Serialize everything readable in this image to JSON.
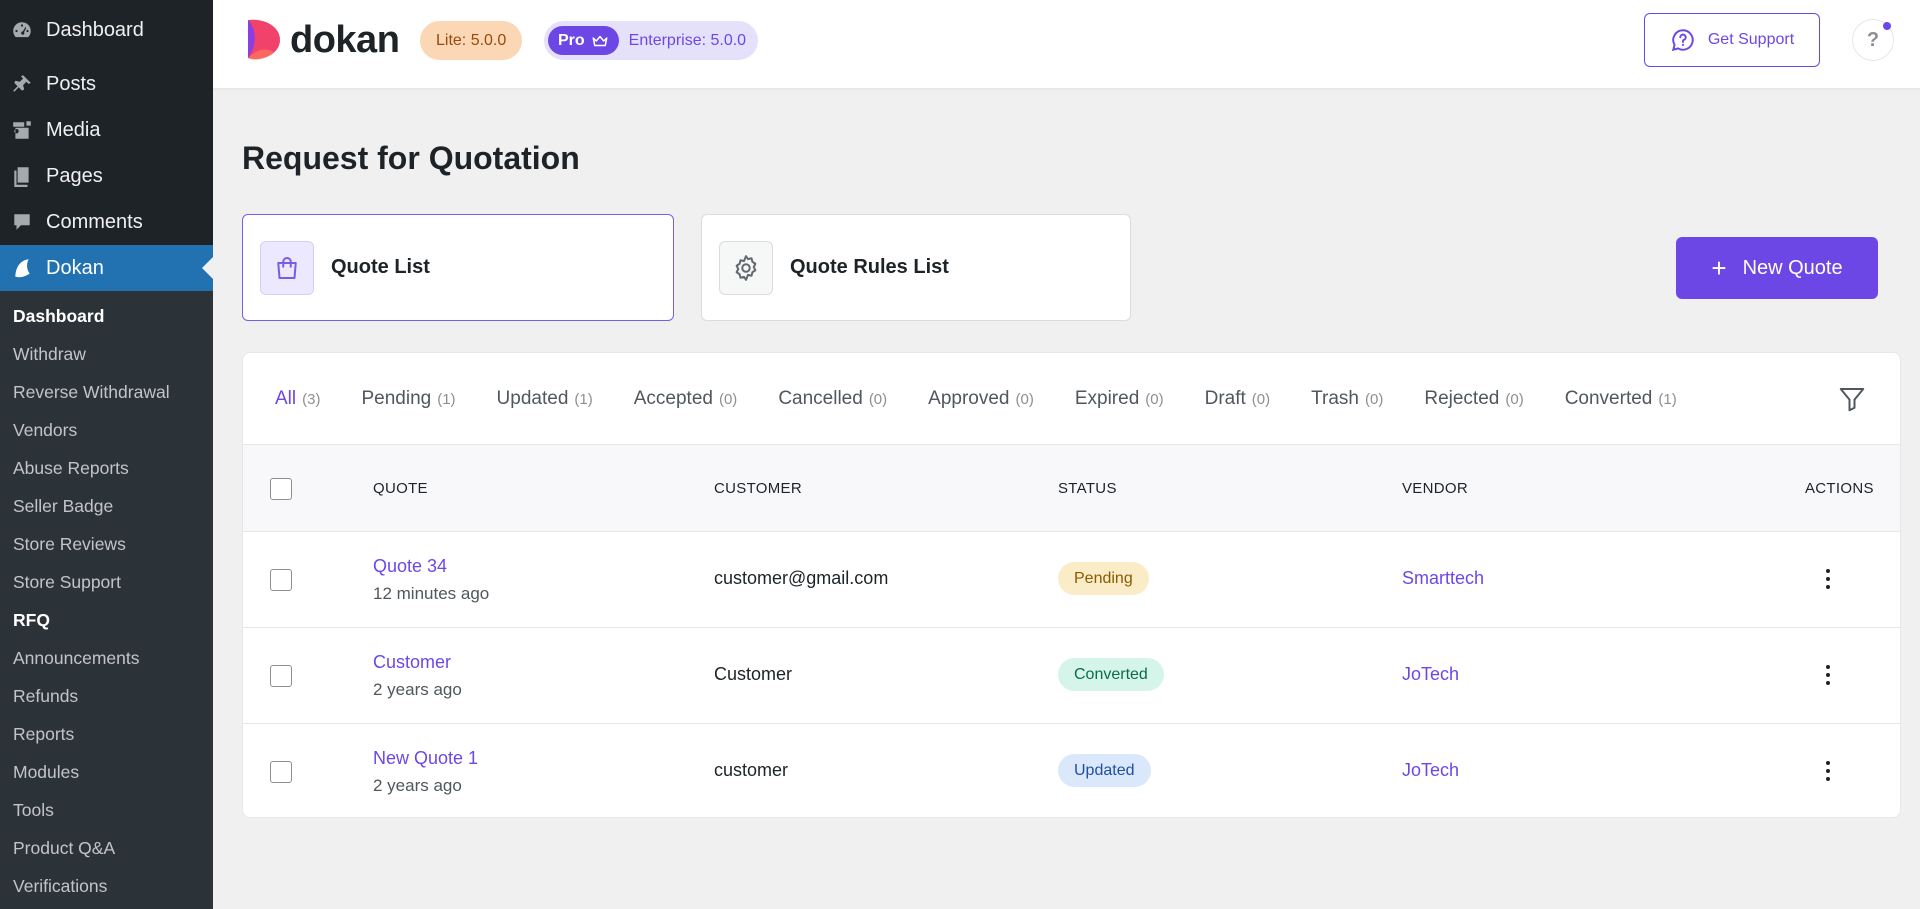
{
  "sidebar": {
    "top_items": [
      {
        "label": "Dashboard",
        "icon": "dashboard-icon"
      },
      {
        "label": "Posts",
        "icon": "pin-icon"
      },
      {
        "label": "Media",
        "icon": "media-icon"
      },
      {
        "label": "Pages",
        "icon": "pages-icon"
      },
      {
        "label": "Comments",
        "icon": "comments-icon"
      },
      {
        "label": "Dokan",
        "icon": "dokan-icon"
      }
    ],
    "sub_items": [
      "Dashboard",
      "Withdraw",
      "Reverse Withdrawal",
      "Vendors",
      "Abuse Reports",
      "Seller Badge",
      "Store Reviews",
      "Store Support",
      "RFQ",
      "Announcements",
      "Refunds",
      "Reports",
      "Modules",
      "Tools",
      "Product Q&A",
      "Verifications"
    ]
  },
  "header": {
    "logo_text": "dokan",
    "lite_badge": "Lite: 5.0.0",
    "pro_label": "Pro",
    "enterprise_badge": "Enterprise: 5.0.0",
    "support_label": "Get Support",
    "help_label": "?"
  },
  "main": {
    "title": "Request for Quotation",
    "tabs": [
      {
        "label": "Quote List",
        "icon": "bag-icon"
      },
      {
        "label": "Quote Rules List",
        "icon": "gear-icon"
      }
    ],
    "new_quote_label": "New Quote",
    "status_filters": [
      {
        "label": "All",
        "count": "(3)"
      },
      {
        "label": "Pending",
        "count": "(1)"
      },
      {
        "label": "Updated",
        "count": "(1)"
      },
      {
        "label": "Accepted",
        "count": "(0)"
      },
      {
        "label": "Cancelled",
        "count": "(0)"
      },
      {
        "label": "Approved",
        "count": "(0)"
      },
      {
        "label": "Expired",
        "count": "(0)"
      },
      {
        "label": "Draft",
        "count": "(0)"
      },
      {
        "label": "Trash",
        "count": "(0)"
      },
      {
        "label": "Rejected",
        "count": "(0)"
      },
      {
        "label": "Converted",
        "count": "(1)"
      }
    ],
    "table": {
      "headers": {
        "quote": "QUOTE",
        "customer": "CUSTOMER",
        "status": "STATUS",
        "vendor": "VENDOR",
        "actions": "ACTIONS"
      },
      "rows": [
        {
          "title": "Quote 34",
          "time": "12 minutes ago",
          "customer": "customer@gmail.com",
          "status": "Pending",
          "vendor": "Smarttech"
        },
        {
          "title": "Customer",
          "time": "2 years ago",
          "customer": "Customer",
          "status": "Converted",
          "vendor": "JoTech"
        },
        {
          "title": "New Quote 1",
          "time": "2 years ago",
          "customer": "customer",
          "status": "Updated",
          "vendor": "JoTech"
        }
      ]
    }
  },
  "colors": {
    "accent": "#6d47e6",
    "wp_sidebar": "#1d2327",
    "wp_active": "#2271b1"
  }
}
